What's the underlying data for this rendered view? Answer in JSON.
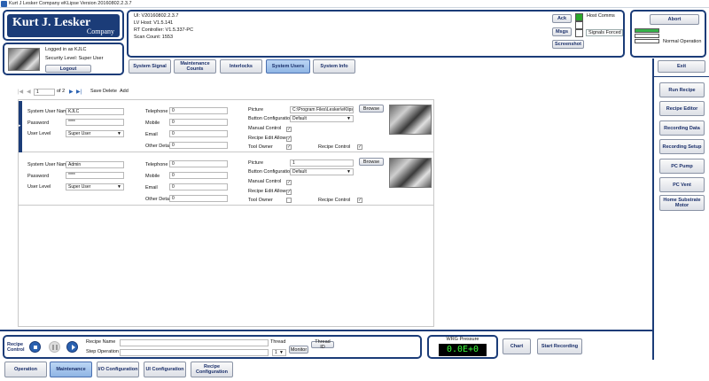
{
  "window": {
    "title": "Kurt J Lesker Company eKLipse Version 20160802.2.3.7"
  },
  "logo": {
    "line1": "Kurt J. Lesker",
    "line2": "Company"
  },
  "user": {
    "logged_in": "Logged in as KJLC",
    "security": "Security Level: Super User",
    "logout": "Logout"
  },
  "versions": {
    "ui": "UI: V20160802.2.3.7",
    "lv_host": "LV Host: V1.5.141",
    "rt": "RT Controller: V1.5.337-PC",
    "scan": "Scan Count: 1553"
  },
  "header_buttons": {
    "ack": "Ack",
    "msgs": "Msgs",
    "screenshot": "Screenshot"
  },
  "status": {
    "host_comms": "Host Comms",
    "signals_forced": "Signals Forced",
    "normal_operation": "Normal Operation",
    "abort": "Abort",
    "exit": "Exit"
  },
  "tabs": [
    {
      "label": "System Signal"
    },
    {
      "label": "Maintenance Counts"
    },
    {
      "label": "Interlocks"
    },
    {
      "label": "System Users"
    },
    {
      "label": "System Info"
    }
  ],
  "navigator": {
    "page": "1",
    "of": "of 2",
    "save": "Save",
    "delete": "Delete",
    "add": "Add"
  },
  "labels": {
    "name": "System User Name",
    "password": "Password",
    "level": "User Level",
    "telephone": "Telephone",
    "mobile": "Mobile",
    "email": "Email",
    "other": "Other Detail",
    "picture": "Picture",
    "button_config": "Button Configuration",
    "manual": "Manual Control",
    "recipe_edit": "Recipe Edit Allowed",
    "tool_owner": "Tool Owner",
    "recipe_control": "Recipe Control",
    "browse": "Browse"
  },
  "users": [
    {
      "name": "KJLC",
      "password": "****",
      "level": "Super User",
      "telephone": "0",
      "mobile": "0",
      "email": "0",
      "other": "0",
      "picture": "C:\\Program Files\\Lesker\\eKlipse\\el",
      "button_config": "Default",
      "manual": "✓",
      "recipe_edit": "✓",
      "tool_owner": "✓",
      "recipe_control": "✓"
    },
    {
      "name": "Admin",
      "password": "****",
      "level": "Super User",
      "telephone": "0",
      "mobile": "0",
      "email": "0",
      "other": "0",
      "picture": "1",
      "button_config": "Default",
      "manual": "✓",
      "recipe_edit": "✓",
      "tool_owner": "",
      "recipe_control": "✓"
    }
  ],
  "right_nav": [
    {
      "label": "Run Recipe"
    },
    {
      "label": "Recipe Editor"
    },
    {
      "label": "Recording Data"
    },
    {
      "label": "Recording Setup"
    },
    {
      "label": "PC Pump"
    },
    {
      "label": "PC Vent"
    },
    {
      "label": "Home Substrate Motor"
    }
  ],
  "recipe": {
    "label": "Recipe Control",
    "name_label": "Recipe Name",
    "step_label": "Step Operation",
    "thread_label": "Thread",
    "thread_value": "1",
    "monitor": "Monitor",
    "thread_id": "Thread ID"
  },
  "wrg": {
    "label": "WRG Pressure",
    "value": "0.0E+0"
  },
  "bottom_buttons": {
    "chart": "Chart",
    "start_recording": "Start Recording"
  },
  "bottom_tabs": [
    {
      "label": "Operation"
    },
    {
      "label": "Maintenance"
    },
    {
      "label": "I/O Configuration"
    },
    {
      "label": "UI Configuration"
    },
    {
      "label": "Recipe Configuration"
    }
  ]
}
